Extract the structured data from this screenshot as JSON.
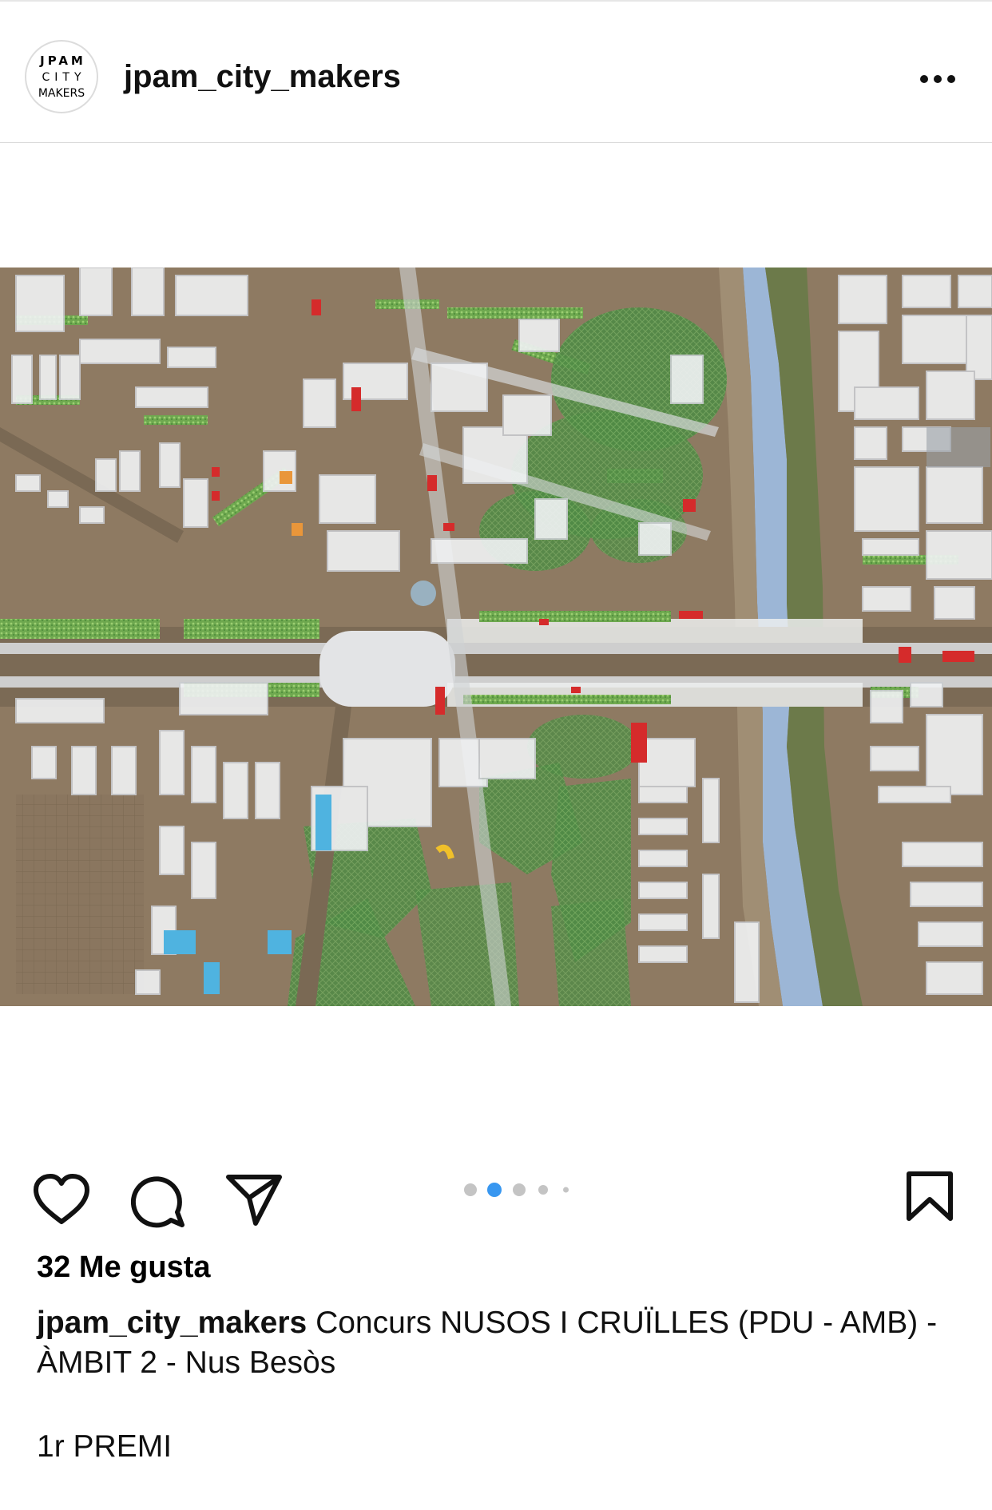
{
  "post": {
    "username": "jpam_city_makers",
    "avatar_text": {
      "line1": "JPAM",
      "line2": "CITY",
      "line3": "MAKERS"
    },
    "more_icon": "more-horizontal-icon",
    "likes": "32 Me gusta",
    "caption_user": "jpam_city_makers",
    "caption_text": "Concurs NUSOS I CRUÏLLES (PDU - AMB) - ÀMBIT 2 - Nus Besòs",
    "caption_extra": "1r PREMI",
    "carousel": {
      "total": 5,
      "active": 2
    },
    "action_icons": [
      "heart-icon",
      "comment-icon",
      "share-icon",
      "bookmark-icon"
    ]
  },
  "colors": {
    "active_dot": "#3897f0",
    "inactive_dot": "#c4c4c4",
    "cardboard": "#8e7a62",
    "river": "#9cb6d6",
    "greenery": "#5f9a4a"
  }
}
